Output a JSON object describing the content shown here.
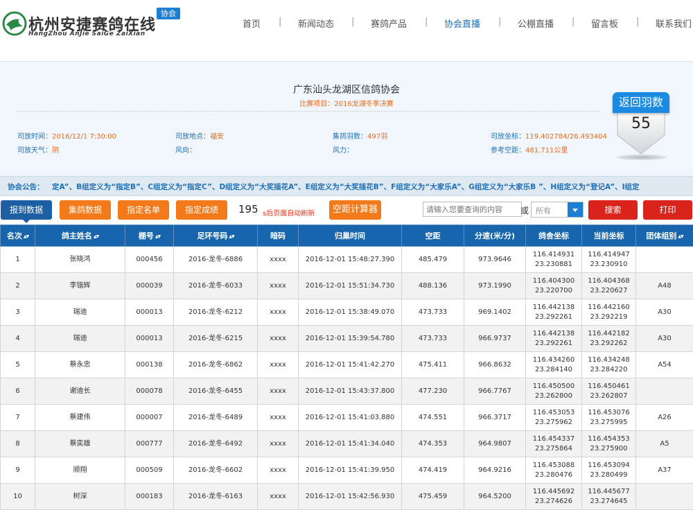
{
  "header": {
    "logo_title": "杭州安捷赛鸽在线",
    "logo_subtitle": "HangZhou AnJie SaiGe ZaiXian",
    "logo_tag": "协会",
    "nav": [
      {
        "label": "首页",
        "active": false
      },
      {
        "label": "新闻动态",
        "active": false
      },
      {
        "label": "赛鸽产品",
        "active": false
      },
      {
        "label": "协会直播",
        "active": true
      },
      {
        "label": "公棚直播",
        "active": false
      },
      {
        "label": "留言板",
        "active": false
      },
      {
        "label": "联系我们",
        "active": false
      }
    ],
    "separator": "|"
  },
  "info": {
    "association": "广东汕头龙湖区信鸽协会",
    "event_label": "比赛项目：",
    "event_value": "2016龙湖冬季决赛",
    "release_time_label": "司放时间：",
    "release_time": "2016/12/1 7:30:00",
    "release_place_label": "司放地点：",
    "release_place": "福安",
    "count_label": "集鸽羽数：",
    "count": "497羽",
    "coord_label": "司放坐标：",
    "coord": "119.402784/26.493404",
    "weather_label": "司放天气：",
    "weather": "阴",
    "wind_dir_label": "风向：",
    "wind_dir": "",
    "wind_force_label": "风力：",
    "wind_force": "",
    "ref_dist_label": "参考空距：",
    "ref_dist": "481.711公里",
    "returned_title": "返回羽数",
    "returned_count": "55"
  },
  "notice": {
    "label": "协会公告：",
    "text": "定A”、B组定义为“指定B”、C组定义为“指定C”、D组定义为“大奖插花A”、E组定义为“大奖插花B”、F组定义为“大家乐A”、G组定义为“大家乐B ”、H组定义为“登记A”、I组定"
  },
  "toolbar": {
    "buttons": [
      "报到数据",
      "集鸽数据",
      "指定名单",
      "指定成绩"
    ],
    "countdown": "195",
    "countdown_text": "s后页面自动刷新",
    "calc_button": "空距计算器",
    "search_placeholder": "请输入您要查询的内容",
    "or_label": "或",
    "select_value": "所有",
    "search_button": "搜索",
    "print_button": "打印"
  },
  "colors": {
    "primary": "#1766ad",
    "orange": "#f27a1a",
    "red": "#d9231b",
    "label_blue": "#1f6fb4",
    "value_orange": "#e86a1c"
  },
  "table": {
    "headers": [
      "名次",
      "鸽主姓名",
      "棚号",
      "足环号码",
      "暗码",
      "归巢时间",
      "空距",
      "分速(米/分)",
      "鸽舍坐标",
      "当前坐标",
      "团体组别"
    ],
    "sortable": [
      true,
      true,
      true,
      true,
      false,
      false,
      false,
      false,
      false,
      false,
      true
    ],
    "rows": [
      [
        "1",
        "张晓鸿",
        "000456",
        "2016-龙冬-6886",
        "xxxx",
        "2016-12-01 15:48:27.390",
        "485.479",
        "973.9646",
        "116.414931|23.230881",
        "116.414947|23.230910",
        ""
      ],
      [
        "2",
        "李锴辉",
        "000039",
        "2016-龙冬-6033",
        "xxxx",
        "2016-12-01 15:51:34.730",
        "488.136",
        "973.1990",
        "116.404300|23.220700",
        "116.404368|23.220627",
        "A48"
      ],
      [
        "3",
        "瑞迪",
        "000013",
        "2016-龙冬-6212",
        "xxxx",
        "2016-12-01 15:38:49.070",
        "473.733",
        "969.1402",
        "116.442138|23.292261",
        "116.442160|23.292219",
        "A30"
      ],
      [
        "4",
        "瑞迪",
        "000013",
        "2016-龙冬-6215",
        "xxxx",
        "2016-12-01 15:39:54.780",
        "473.733",
        "966.9737",
        "116.442138|23.292261",
        "116.442182|23.292262",
        "A30"
      ],
      [
        "5",
        "蔡永忠",
        "000138",
        "2016-龙冬-6862",
        "xxxx",
        "2016-12-01 15:41:42.270",
        "475.411",
        "966.8632",
        "116.434260|23.284140",
        "116.434248|23.284220",
        "A54"
      ],
      [
        "6",
        "谢迪长",
        "000078",
        "2016-龙冬-6455",
        "xxxx",
        "2016-12-01 15:43:37.800",
        "477.230",
        "966.7767",
        "116.450500|23.262800",
        "116.450461|23.262807",
        ""
      ],
      [
        "7",
        "蔡建伟",
        "000007",
        "2016-龙冬-6489",
        "xxxx",
        "2016-12-01 15:41:03.880",
        "474.551",
        "966.3717",
        "116.453053|23.275962",
        "116.453076|23.275995",
        "A26"
      ],
      [
        "8",
        "蔡奕雄",
        "000777",
        "2016-龙冬-6492",
        "xxxx",
        "2016-12-01 15:41:34.040",
        "474.353",
        "964.9807",
        "116.454337|23.275864",
        "116.454353|23.275900",
        "A5"
      ],
      [
        "9",
        "顺翔",
        "000509",
        "2016-龙冬-6602",
        "xxxx",
        "2016-12-01 15:41:39.950",
        "474.419",
        "964.9216",
        "116.453088|23.280476",
        "116.453094|23.280499",
        "A37"
      ],
      [
        "10",
        "树深",
        "000183",
        "2016-龙冬-6163",
        "xxxx",
        "2016-12-01 15:42:56.930",
        "475.459",
        "964.5200",
        "116.445692|23.274626",
        "116.445677|23.274645",
        ""
      ]
    ]
  }
}
